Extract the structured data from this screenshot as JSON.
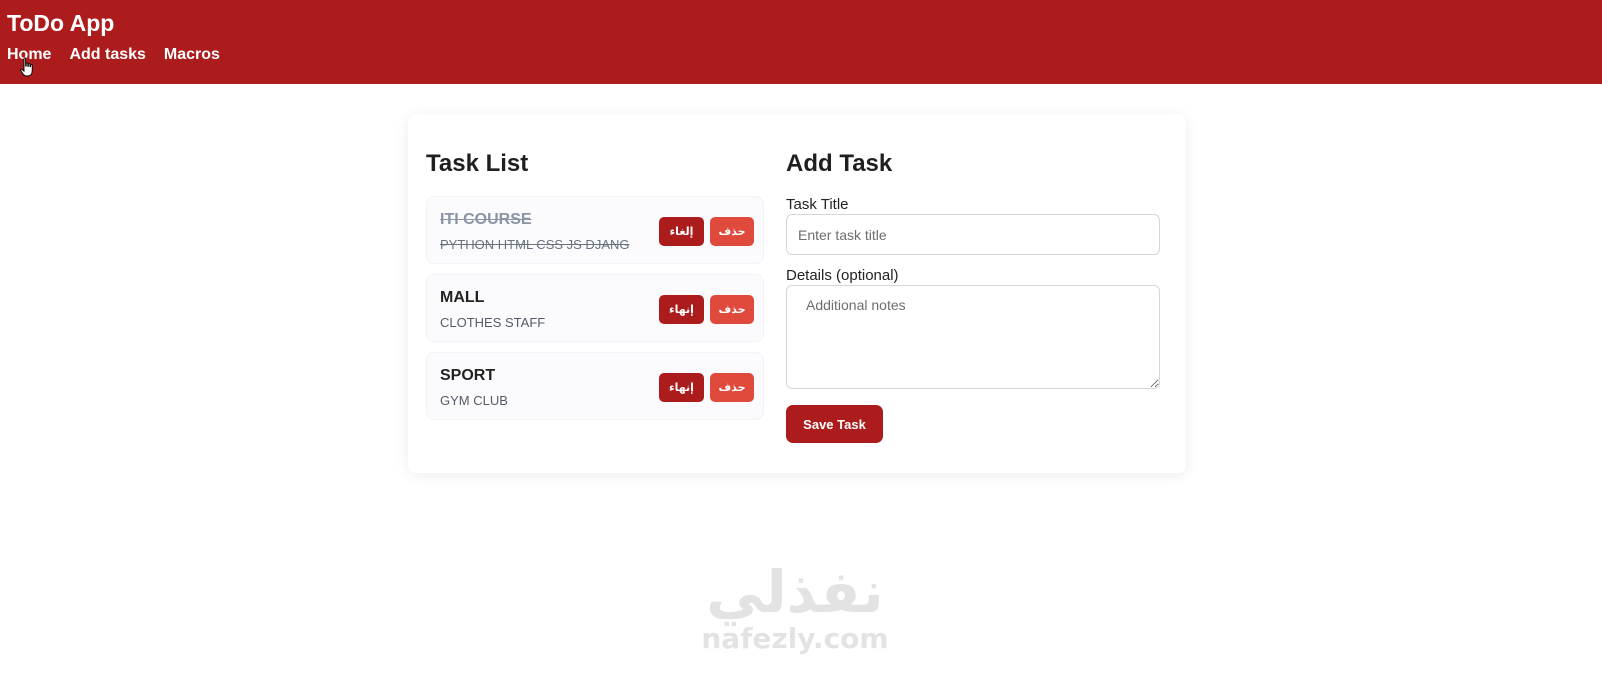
{
  "header": {
    "title": "ToDo App",
    "nav": [
      "Home",
      "Add tasks",
      "Macros"
    ],
    "color": "#ad1c1c"
  },
  "task_list": {
    "title": "Task List",
    "tasks": [
      {
        "title": "ITI COURSE",
        "details": "PYTHON HTML CSS JS DJANG",
        "completed": true,
        "toggle_label": "إلغاء",
        "delete_label": "حذف"
      },
      {
        "title": "MALL",
        "details": "CLOTHES STAFF",
        "completed": false,
        "toggle_label": "إنهاء",
        "delete_label": "حذف"
      },
      {
        "title": "SPORT",
        "details": "GYM CLUB",
        "completed": false,
        "toggle_label": "إنهاء",
        "delete_label": "حذف"
      }
    ]
  },
  "add_task": {
    "title": "Add Task",
    "title_label": "Task Title",
    "title_placeholder": "Enter task title",
    "title_value": "",
    "details_label": "Details (optional)",
    "details_placeholder": "Additional notes",
    "details_value": "",
    "save_label": "Save Task"
  },
  "watermark": {
    "arabic": "نفذلي",
    "latin": "nafezly.com"
  },
  "colors": {
    "primary": "#ac1c1c",
    "delete": "#e04a3d"
  },
  "icons": {
    "cursor": "hand-pointer-icon"
  }
}
